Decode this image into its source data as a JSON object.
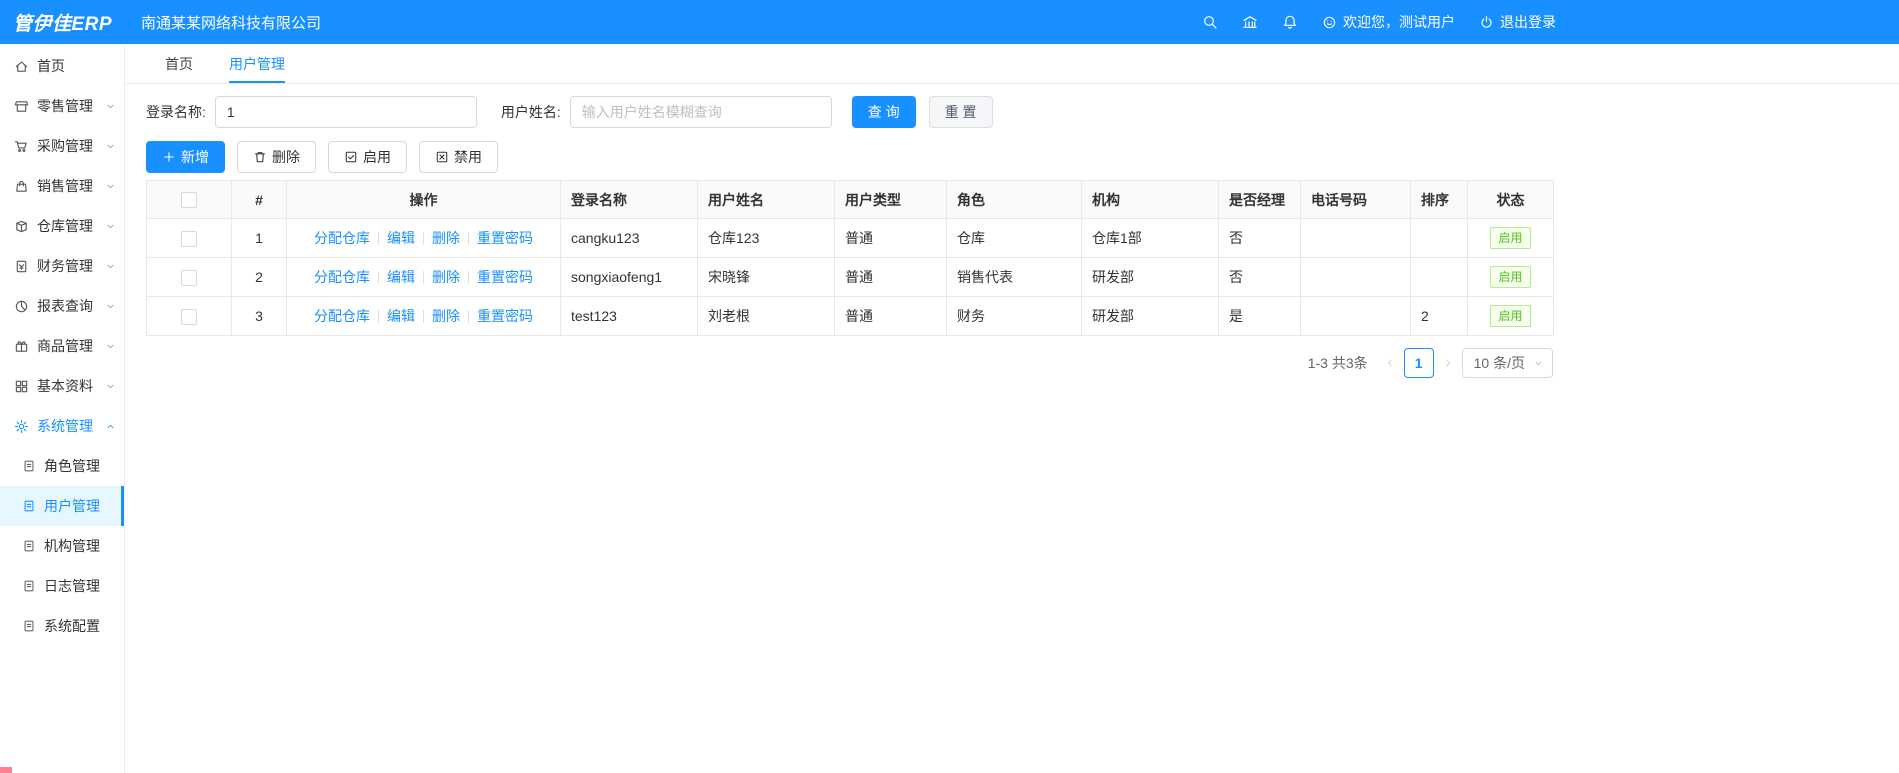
{
  "colors": {
    "primary": "#1890ff",
    "success": "#52c41a",
    "topbar_bg": "#1890ff",
    "active_item_bg": "#e6f7ff"
  },
  "topbar": {
    "logo": "管伊佳ERP",
    "company": "南通某某网络科技有限公司",
    "welcome": "欢迎您，测试用户",
    "logout": "退出登录"
  },
  "sidebar": {
    "items": [
      {
        "id": "home",
        "icon": "home",
        "label": "首页"
      },
      {
        "id": "retail",
        "icon": "retail",
        "label": "零售管理",
        "chevron": "down"
      },
      {
        "id": "purchase",
        "icon": "purchase",
        "label": "采购管理",
        "chevron": "down"
      },
      {
        "id": "sales",
        "icon": "sales",
        "label": "销售管理",
        "chevron": "down"
      },
      {
        "id": "warehouse",
        "icon": "warehouse",
        "label": "仓库管理",
        "chevron": "down"
      },
      {
        "id": "finance",
        "icon": "finance",
        "label": "财务管理",
        "chevron": "down"
      },
      {
        "id": "report",
        "icon": "report",
        "label": "报表查询",
        "chevron": "down"
      },
      {
        "id": "goods",
        "icon": "goods",
        "label": "商品管理",
        "chevron": "down"
      },
      {
        "id": "basic",
        "icon": "basic",
        "label": "基本资料",
        "chevron": "down"
      },
      {
        "id": "system",
        "icon": "system",
        "label": "系统管理",
        "chevron": "up",
        "active": true,
        "expanded": true
      }
    ],
    "sub_items": [
      {
        "id": "role",
        "label": "角色管理"
      },
      {
        "id": "user",
        "label": "用户管理",
        "active": true
      },
      {
        "id": "org",
        "label": "机构管理"
      },
      {
        "id": "log",
        "label": "日志管理"
      },
      {
        "id": "config",
        "label": "系统配置"
      }
    ]
  },
  "tabs": [
    {
      "label": "首页"
    },
    {
      "label": "用户管理",
      "active": true
    }
  ],
  "filters": {
    "login_name_label": "登录名称:",
    "login_name_value": "1",
    "user_name_label": "用户姓名:",
    "user_name_placeholder": "输入用户姓名模糊查询",
    "search_label": "查 询",
    "reset_label": "重 置"
  },
  "toolbar": {
    "add_label": "新增",
    "delete_label": "删除",
    "enable_label": "启用",
    "disable_label": "禁用"
  },
  "table": {
    "headers": [
      "#",
      "操作",
      "登录名称",
      "用户姓名",
      "用户类型",
      "角色",
      "机构",
      "是否经理",
      "电话号码",
      "排序",
      "状态"
    ],
    "rows": [
      {
        "seq": "1",
        "ops": [
          "分配仓库",
          "编辑",
          "删除",
          "重置密码"
        ],
        "login_name": "cangku123",
        "user_name": "仓库123",
        "user_type": "普通",
        "role": "仓库",
        "org": "仓库1部",
        "is_manager": "否",
        "phone": "",
        "sort": "",
        "status": "启用"
      },
      {
        "seq": "2",
        "ops": [
          "分配仓库",
          "编辑",
          "删除",
          "重置密码"
        ],
        "login_name": "songxiaofeng1",
        "user_name": "宋晓锋",
        "user_type": "普通",
        "role": "销售代表",
        "org": "研发部",
        "is_manager": "否",
        "phone": "",
        "sort": "",
        "status": "启用"
      },
      {
        "seq": "3",
        "ops": [
          "分配仓库",
          "编辑",
          "删除",
          "重置密码"
        ],
        "login_name": "test123",
        "user_name": "刘老根",
        "user_type": "普通",
        "role": "财务",
        "org": "研发部",
        "is_manager": "是",
        "phone": "",
        "sort": "2",
        "status": "启用"
      }
    ]
  },
  "pagination": {
    "total": "1-3 共3条",
    "current": "1",
    "page_size": "10 条/页"
  }
}
